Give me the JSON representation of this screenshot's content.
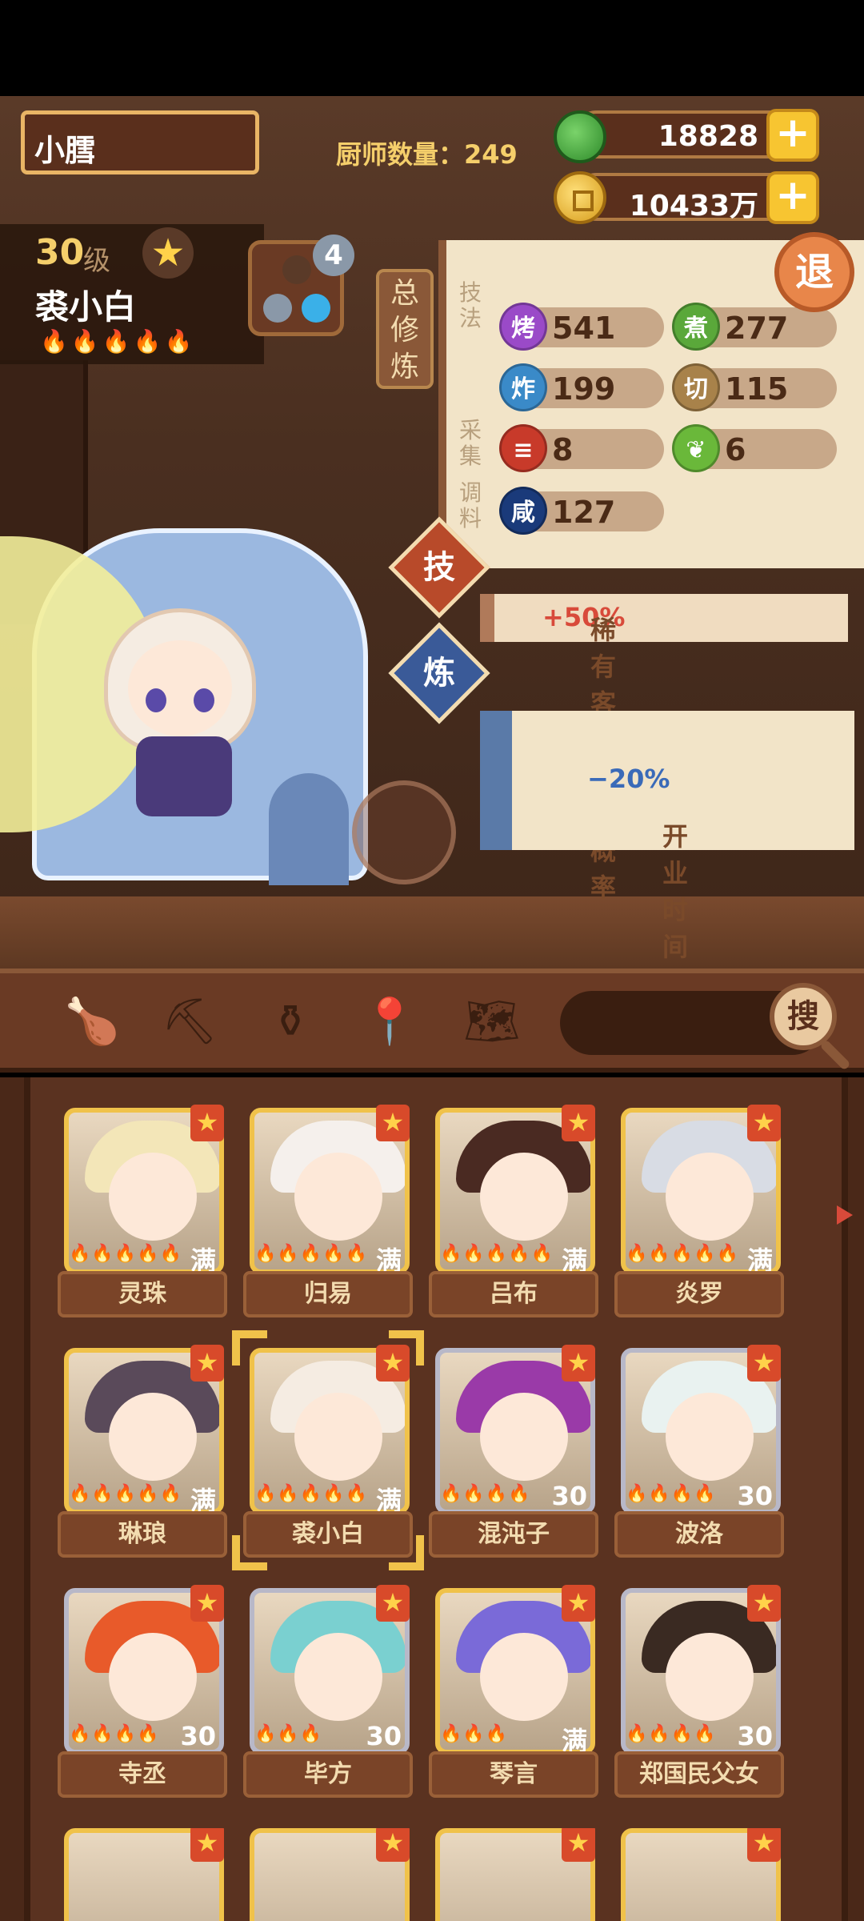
{
  "player": {
    "name": "小膤",
    "chef_count_label": "厨师数量：",
    "chef_count": "249"
  },
  "resources": {
    "jade": "18828",
    "coins": "10433万",
    "plus": "+"
  },
  "chef": {
    "level": "30",
    "level_unit": "级",
    "name": "裘小白",
    "flames": "🔥🔥🔥🔥🔥",
    "equip_count": "4"
  },
  "cultivation": {
    "tab_label": "总修炼",
    "quit_label": "退",
    "sections": {
      "technique": "技法",
      "gather": "采集",
      "seasoning": "调料"
    },
    "stats": {
      "roast": {
        "icon": "烤",
        "value": "541"
      },
      "boil": {
        "icon": "煮",
        "value": "277"
      },
      "fry": {
        "icon": "炸",
        "value": "199"
      },
      "cut": {
        "icon": "切",
        "value": "115"
      },
      "meat": {
        "value": "8"
      },
      "veg": {
        "value": "6"
      },
      "salt": {
        "icon": "咸",
        "value": "127"
      }
    }
  },
  "skills": {
    "skill_btn": "技",
    "refine_btn": "炼",
    "skill_effect_text": "稀有客人出现概率",
    "skill_effect_value": "+50%",
    "refine_effect_text": "开业时间",
    "refine_effect_value": "−20%"
  },
  "toolbar": {
    "search_btn": "搜",
    "icons": [
      "drumstick-icon",
      "shovel-icon",
      "jar-icon",
      "location-icon",
      "map-question-icon"
    ]
  },
  "chef_list": [
    {
      "name": "灵珠",
      "tag": "满",
      "flames": "🔥🔥🔥🔥🔥",
      "hair": "#f3e6b8"
    },
    {
      "name": "归易",
      "tag": "满",
      "flames": "🔥🔥🔥🔥🔥",
      "hair": "#f5f0ec"
    },
    {
      "name": "吕布",
      "tag": "满",
      "flames": "🔥🔥🔥🔥🔥",
      "hair": "#4a2a22"
    },
    {
      "name": "炎罗",
      "tag": "满",
      "flames": "🔥🔥🔥🔥🔥",
      "hair": "#d8dce4"
    },
    {
      "name": "琳琅",
      "tag": "满",
      "flames": "🔥🔥🔥🔥🔥",
      "hair": "#5a4a5a"
    },
    {
      "name": "裘小白",
      "tag": "满",
      "flames": "🔥🔥🔥🔥🔥",
      "hair": "#f5ece2"
    },
    {
      "name": "混沌子",
      "tag": "30",
      "flames": "🔥🔥🔥🔥",
      "hair": "#9a3aa8"
    },
    {
      "name": "波洛",
      "tag": "30",
      "flames": "🔥🔥🔥🔥",
      "hair": "#e9f2f0"
    },
    {
      "name": "寺丞",
      "tag": "30",
      "flames": "🔥🔥🔥🔥",
      "hair": "#e85a2a"
    },
    {
      "name": "毕方",
      "tag": "30",
      "flames": "🔥🔥🔥",
      "hair": "#7ad0d0"
    },
    {
      "name": "琴言",
      "tag": "满",
      "flames": "🔥🔥🔥",
      "hair": "#7a6ad8"
    },
    {
      "name": "郑国民父女",
      "tag": "30",
      "flames": "🔥🔥🔥🔥",
      "hair": "#3a2a22"
    }
  ],
  "colors": {
    "accent_gold": "#f0c24a",
    "panel_brown": "#5a2f1c",
    "roast_purple": "#9a4ac8",
    "boil_green": "#5aa83a",
    "fry_blue": "#3a8ac8",
    "cut_tan": "#a8824a"
  }
}
